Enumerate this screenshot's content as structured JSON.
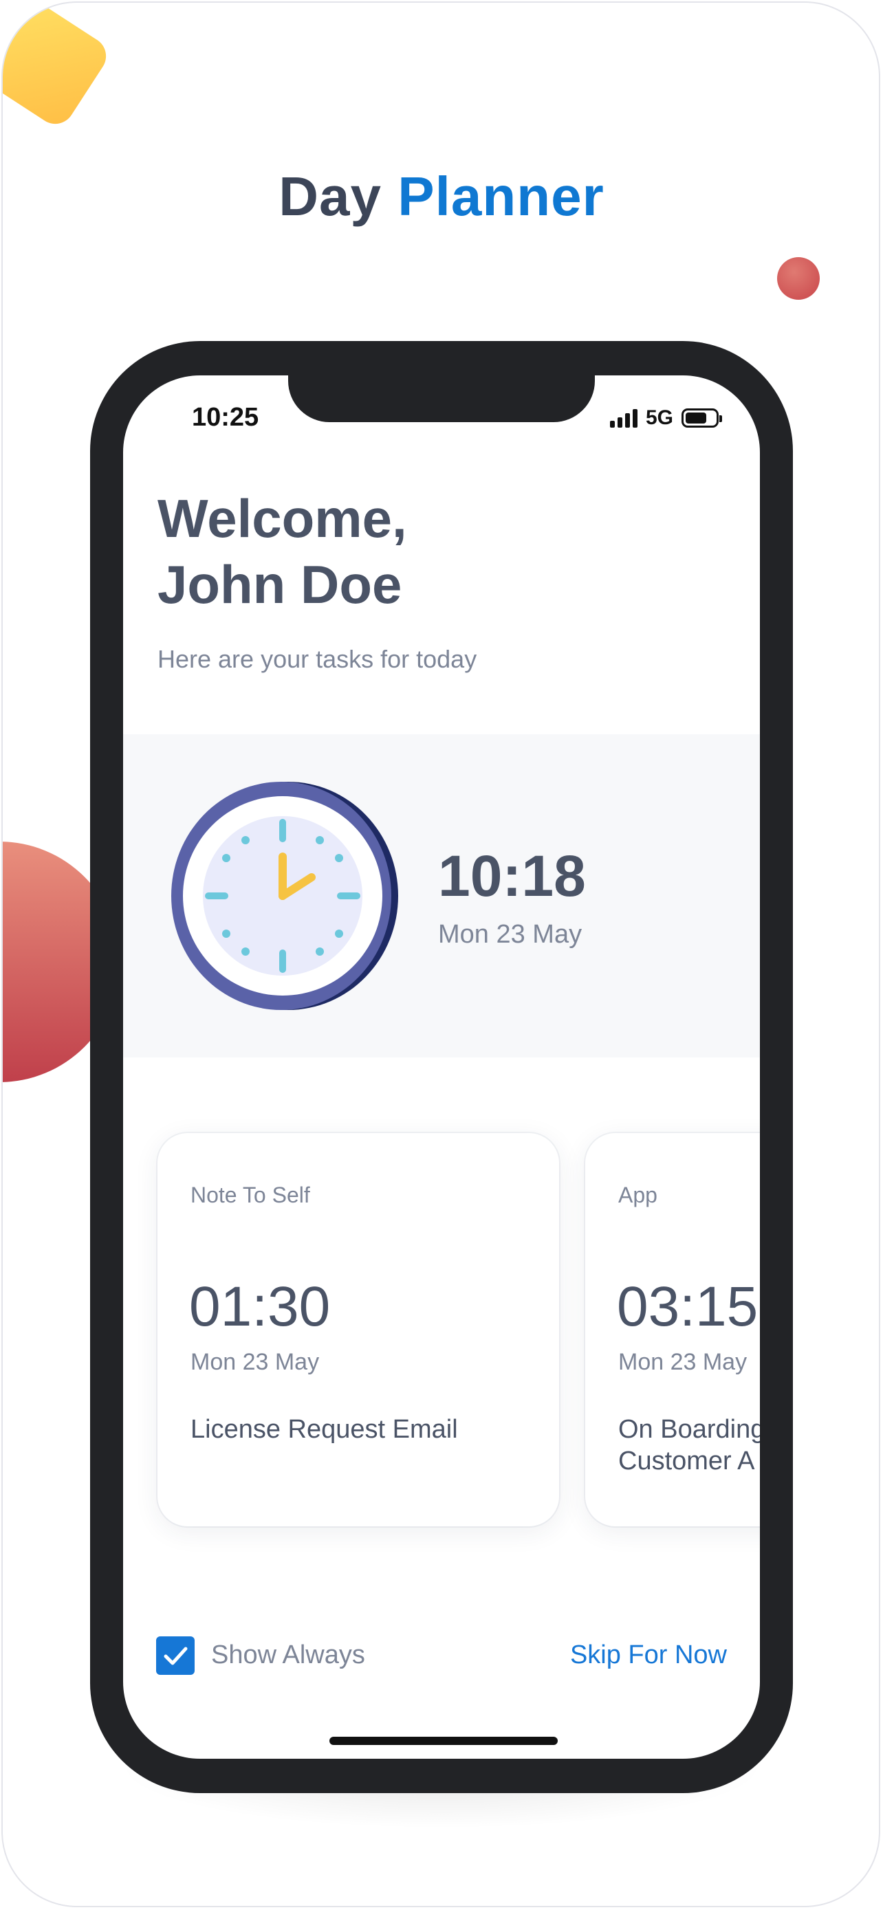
{
  "app_title": {
    "primary": "Day",
    "accent": "Planner"
  },
  "status_bar": {
    "time": "10:25",
    "network": "5G"
  },
  "greeting": {
    "line1": "Welcome,",
    "line2": "John Doe",
    "subtitle": "Here are your tasks for today"
  },
  "current": {
    "time": "10:18",
    "date": "Mon 23 May"
  },
  "tasks": [
    {
      "category": "Note To Self",
      "time": "01:30",
      "date": "Mon 23 May",
      "title_line1": "License Request Email",
      "title_line2": ""
    },
    {
      "category": "App",
      "time": "03:15",
      "date": "Mon 23 May",
      "title_line1": "On Boarding",
      "title_line2": "Customer A"
    }
  ],
  "footer": {
    "checkbox_label": "Show Always",
    "checked": true,
    "skip_label": "Skip For Now"
  },
  "colors": {
    "accent": "#0f78d2",
    "text": "#4a5366",
    "muted": "#7d8597"
  }
}
